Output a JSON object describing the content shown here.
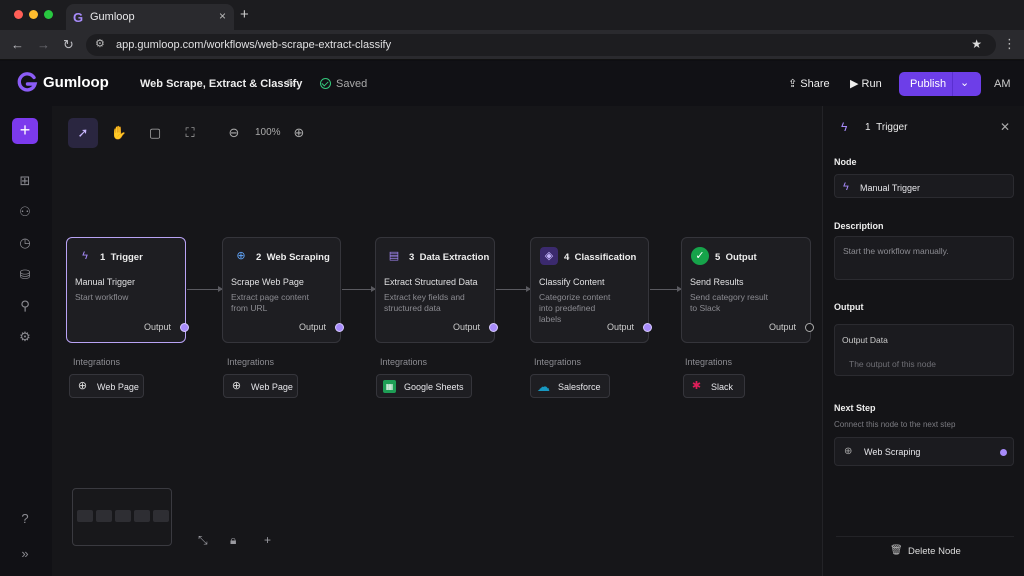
{
  "browser": {
    "tab_title": "Gumloop",
    "tab_close": "×",
    "new_tab": "+",
    "url": "app.gumloop.com/workflows/web-scrape-extract-classify",
    "controls": {
      "back": "←",
      "forward": "→",
      "reload": "↻",
      "star": "★",
      "menu": "⋮"
    }
  },
  "header": {
    "app_name": "Gumloop",
    "workflow_name": "Web Scrape, Extract & Classify",
    "status": "Saved",
    "share_label": "Share",
    "run_label": "Run",
    "publish_label": "Publish",
    "user_initials": "AM",
    "brand_color": "#6d3ee8"
  },
  "toolbar": {
    "zoom": "100%"
  },
  "nodes": [
    {
      "number": "1",
      "title": "Trigger",
      "subtitle": "Manual Trigger",
      "description": "Start workflow",
      "output": "Output",
      "icon": "lightning-icon"
    },
    {
      "number": "2",
      "title": "Web Scraping",
      "subtitle": "Scrape Web Page",
      "description": "Extract page content from URL",
      "output": "Output",
      "icon": "globe-icon"
    },
    {
      "number": "3",
      "title": "Data Extraction",
      "subtitle": "Extract Structured Data",
      "description": "Extract key fields and structured data",
      "output": "Output",
      "icon": "document-icon"
    },
    {
      "number": "4",
      "title": "Classification",
      "subtitle": "Classify Content",
      "description": "Categorize content into predefined labels",
      "output": "Output",
      "icon": "tag-icon"
    },
    {
      "number": "5",
      "title": "Output",
      "subtitle": "Send Results",
      "description": "Send category result to Slack",
      "output": "Output",
      "icon": "check-icon"
    }
  ],
  "integrations": {
    "label": "Integrations",
    "items": [
      "Web Page",
      "Web Page",
      "Google Sheets",
      "Salesforce",
      "Slack"
    ]
  },
  "panel": {
    "number": "1",
    "title": "Trigger",
    "node_label": "Node",
    "node_value": "Manual Trigger",
    "description_label": "Description",
    "description_value": "Start the workflow manually.",
    "output_label": "Output",
    "output_data_label": "Output Data",
    "output_data_value": "The output of this node",
    "next_step_label": "Next Step",
    "next_step_help": "Connect this node to the next step",
    "next_step_value": "Web Scraping",
    "delete_label": "Delete Node"
  }
}
